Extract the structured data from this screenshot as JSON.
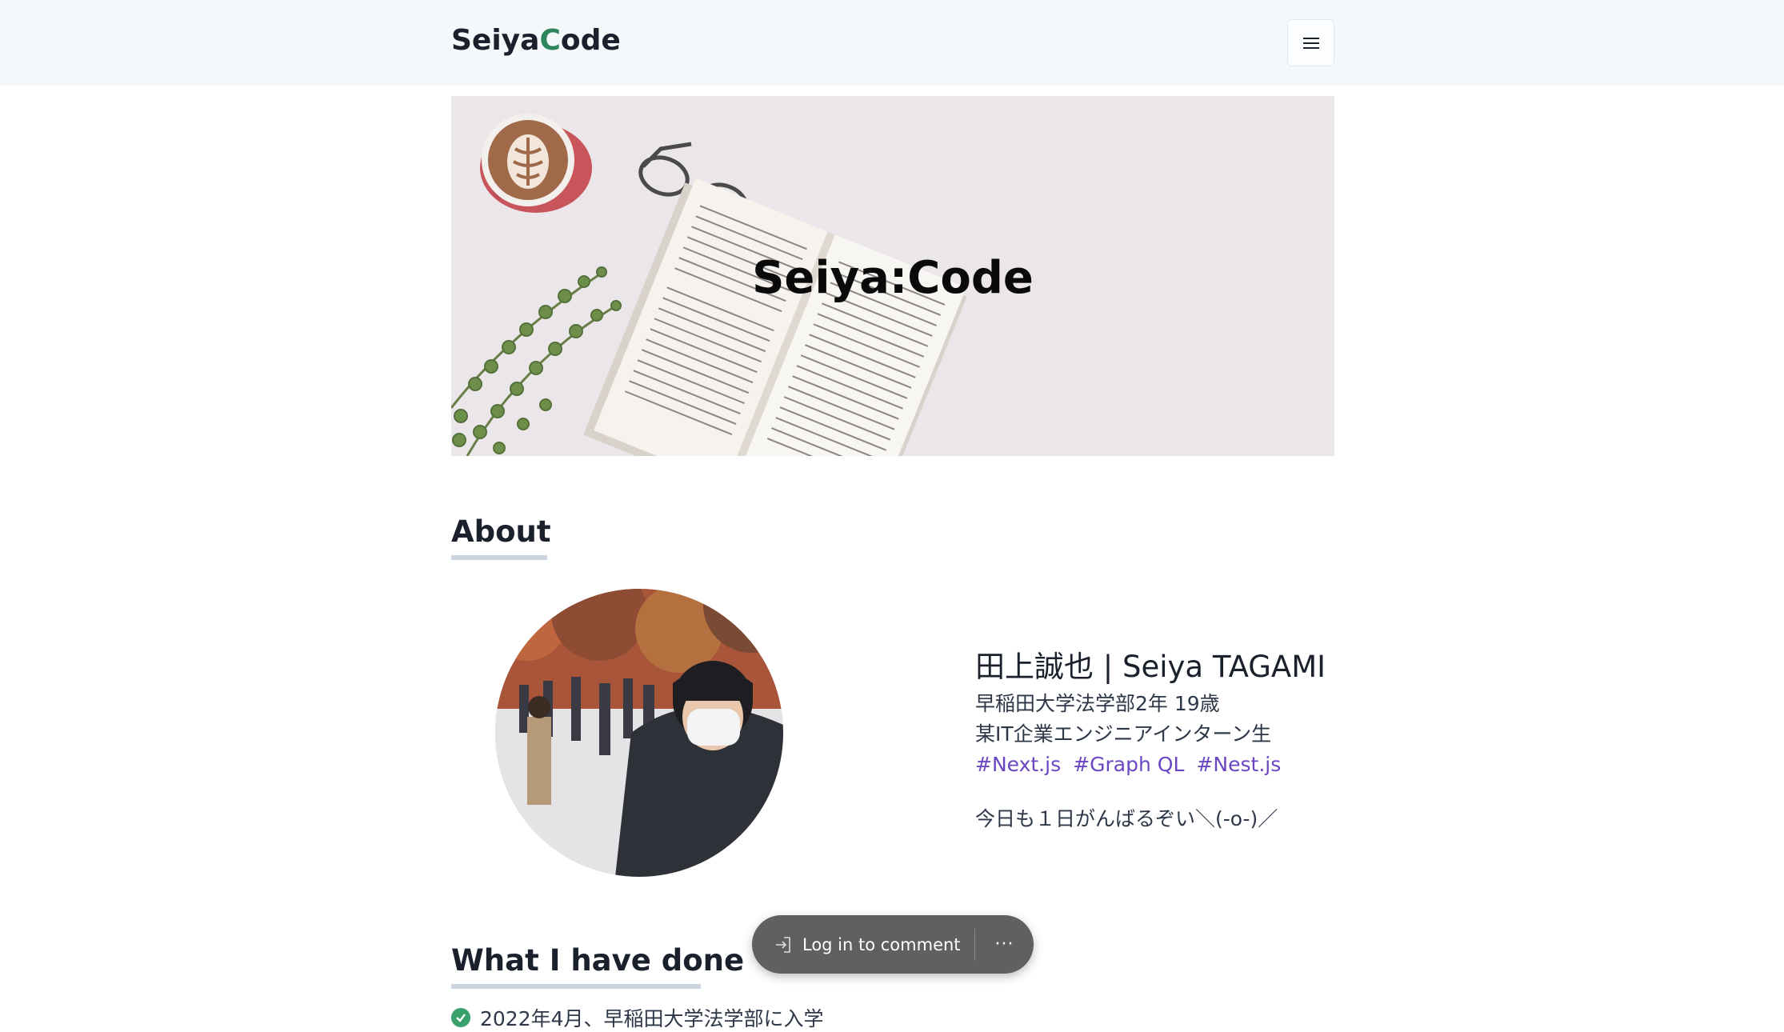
{
  "header": {
    "logo_part1": "Seiya",
    "logo_accent": "C",
    "logo_part2": "ode",
    "menu_icon": "hamburger-icon"
  },
  "hero": {
    "title": "Seiya:Code"
  },
  "about": {
    "heading": "About",
    "name": "田上誠也 | Seiya TAGAMI",
    "line1": "早稲田大学法学部2年 19歳",
    "line2": "某IT企業エンジニアインターン生",
    "tags": [
      "#Next.js",
      "#Graph QL",
      "#Nest.js"
    ],
    "motto": "今日も１日がんばるぞい＼(-o-)／"
  },
  "done": {
    "heading": "What I have done",
    "items": [
      "2022年4月、早稲田大学法学部に入学"
    ]
  },
  "comment_bar": {
    "login_label": "Log in to comment",
    "more_label": "···"
  },
  "colors": {
    "logo_accent": "#2f855a",
    "tag": "#6b46c1",
    "check": "#38a169",
    "header_bg": "#f4f8fb",
    "pill_bg": "#606060"
  }
}
